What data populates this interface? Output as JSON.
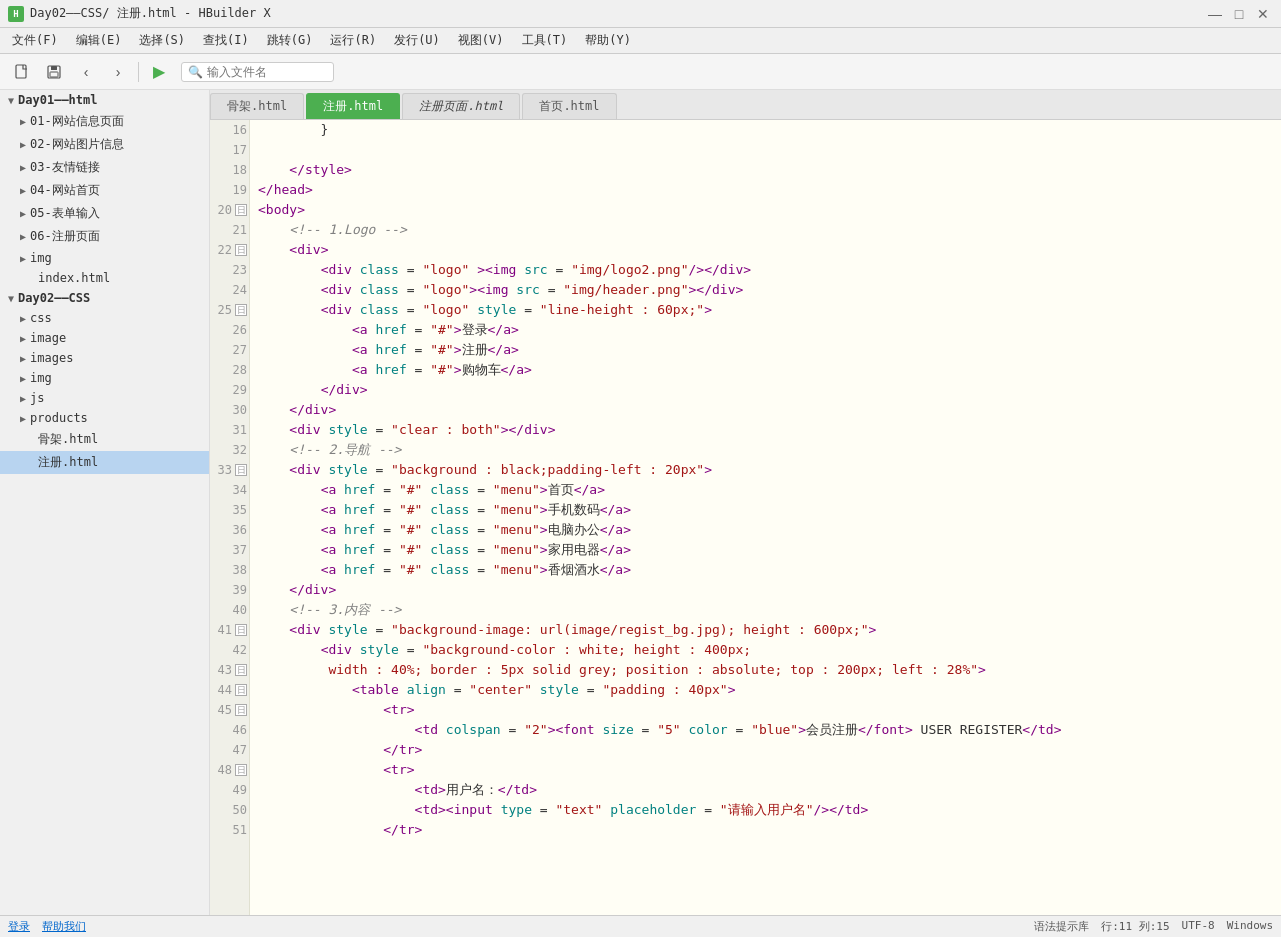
{
  "titlebar": {
    "title": "Day02——CSS/ 注册.html - HBuilder X",
    "icon": "H"
  },
  "menubar": {
    "items": [
      "文件(F)",
      "编辑(E)",
      "选择(S)",
      "查找(I)",
      "跳转(G)",
      "运行(R)",
      "发行(U)",
      "视图(V)",
      "工具(T)",
      "帮助(Y)"
    ]
  },
  "toolbar": {
    "search_placeholder": "输入文件名"
  },
  "tabs": [
    {
      "label": "骨架.html",
      "active": false,
      "unsaved": false
    },
    {
      "label": "注册.html",
      "active": true,
      "unsaved": false
    },
    {
      "label": "注册页面.html",
      "active": false,
      "unsaved": true
    },
    {
      "label": "首页.html",
      "active": false,
      "unsaved": false
    }
  ],
  "sidebar": {
    "items": [
      {
        "level": 0,
        "label": "Day01——html",
        "type": "folder",
        "open": true,
        "toggle": "▼"
      },
      {
        "level": 1,
        "label": "01-网站信息页面",
        "type": "folder",
        "toggle": "▶"
      },
      {
        "level": 1,
        "label": "02-网站图片信息",
        "type": "folder",
        "toggle": "▶"
      },
      {
        "level": 1,
        "label": "03-友情链接",
        "type": "folder",
        "toggle": "▶"
      },
      {
        "level": 1,
        "label": "04-网站首页",
        "type": "folder",
        "toggle": "▶"
      },
      {
        "level": 1,
        "label": "05-表单输入",
        "type": "folder",
        "toggle": "▶"
      },
      {
        "level": 1,
        "label": "06-注册页面",
        "type": "folder",
        "toggle": "▶"
      },
      {
        "level": 1,
        "label": "img",
        "type": "folder",
        "toggle": "▶"
      },
      {
        "level": 1,
        "label": "index.html",
        "type": "file"
      },
      {
        "level": 0,
        "label": "Day02——CSS",
        "type": "folder",
        "open": true,
        "toggle": "▼"
      },
      {
        "level": 1,
        "label": "css",
        "type": "folder",
        "toggle": "▶"
      },
      {
        "level": 1,
        "label": "image",
        "type": "folder",
        "toggle": "▶"
      },
      {
        "level": 1,
        "label": "images",
        "type": "folder",
        "toggle": "▶"
      },
      {
        "level": 1,
        "label": "img",
        "type": "folder",
        "toggle": "▶"
      },
      {
        "level": 1,
        "label": "js",
        "type": "folder",
        "toggle": "▶"
      },
      {
        "level": 1,
        "label": "products",
        "type": "folder",
        "toggle": "▶"
      },
      {
        "level": 1,
        "label": "骨架.html",
        "type": "file"
      },
      {
        "level": 1,
        "label": "注册.html",
        "type": "file",
        "active": true
      }
    ]
  },
  "code_lines": [
    {
      "num": 16,
      "fold": false,
      "content": "        }"
    },
    {
      "num": 17,
      "fold": false,
      "content": ""
    },
    {
      "num": 18,
      "fold": false,
      "content": "    </style>"
    },
    {
      "num": 19,
      "fold": false,
      "content": "</head>"
    },
    {
      "num": 20,
      "fold": true,
      "content": "<body>"
    },
    {
      "num": 21,
      "fold": false,
      "content": "    <!-- 1.Logo -->"
    },
    {
      "num": 22,
      "fold": true,
      "content": "    <div>"
    },
    {
      "num": 23,
      "fold": false,
      "content": "        <div class = \"logo\" ><img src = \"img/logo2.png\"/></div>"
    },
    {
      "num": 24,
      "fold": false,
      "content": "        <div class = \"logo\"><img src = \"img/header.png\"></div>"
    },
    {
      "num": 25,
      "fold": true,
      "content": "        <div class = \"logo\" style = \"line-height : 60px;\">"
    },
    {
      "num": 26,
      "fold": false,
      "content": "            <a href = \"#\">登录</a>"
    },
    {
      "num": 27,
      "fold": false,
      "content": "            <a href = \"#\">注册</a>"
    },
    {
      "num": 28,
      "fold": false,
      "content": "            <a href = \"#\">购物车</a>"
    },
    {
      "num": 29,
      "fold": false,
      "content": "        </div>"
    },
    {
      "num": 30,
      "fold": false,
      "content": "    </div>"
    },
    {
      "num": 31,
      "fold": false,
      "content": "    <div style = \"clear : both\"></div>"
    },
    {
      "num": 32,
      "fold": false,
      "content": "    <!-- 2.导航 -->"
    },
    {
      "num": 33,
      "fold": true,
      "content": "    <div style = \"background : black;padding-left : 20px\">"
    },
    {
      "num": 34,
      "fold": false,
      "content": "        <a href = \"#\" class = \"menu\">首页</a>"
    },
    {
      "num": 35,
      "fold": false,
      "content": "        <a href = \"#\" class = \"menu\">手机数码</a>"
    },
    {
      "num": 36,
      "fold": false,
      "content": "        <a href = \"#\" class = \"menu\">电脑办公</a>"
    },
    {
      "num": 37,
      "fold": false,
      "content": "        <a href = \"#\" class = \"menu\">家用电器</a>"
    },
    {
      "num": 38,
      "fold": false,
      "content": "        <a href = \"#\" class = \"menu\">香烟酒水</a>"
    },
    {
      "num": 39,
      "fold": false,
      "content": "    </div>"
    },
    {
      "num": 40,
      "fold": false,
      "content": "    <!-- 3.内容 -->"
    },
    {
      "num": 41,
      "fold": true,
      "content": "    <div style = \"background-image: url(image/regist_bg.jpg); height : 600px;\">"
    },
    {
      "num": 42,
      "fold": false,
      "content": "        <div style = \"background-color : white; height : 400px;"
    },
    {
      "num": 43,
      "fold": true,
      "content": "         width : 40%; border : 5px solid grey; position : absolute; top : 200px; left : 28%\">"
    },
    {
      "num": 44,
      "fold": true,
      "content": "            <table align = \"center\" style = \"padding : 40px\">"
    },
    {
      "num": 45,
      "fold": true,
      "content": "                <tr>"
    },
    {
      "num": 46,
      "fold": false,
      "content": "                    <td colspan = \"2\"><font size = \"5\" color = \"blue\">会员注册</font> USER REGISTER</td>"
    },
    {
      "num": 47,
      "fold": false,
      "content": "                </tr>"
    },
    {
      "num": 48,
      "fold": true,
      "content": "                <tr>"
    },
    {
      "num": 49,
      "fold": false,
      "content": "                    <td>用户名：</td>"
    },
    {
      "num": 50,
      "fold": false,
      "content": "                    <td><input type = \"text\" placeholder = \"请输入用户名\"/></td>"
    },
    {
      "num": 51,
      "fold": false,
      "content": "                </tr>"
    }
  ],
  "statusbar": {
    "login": "登录",
    "help": "帮助我们",
    "hint": "语法提示库",
    "row_col": "行:11  列:15",
    "encoding": "UTF-8",
    "format": "Windows"
  }
}
